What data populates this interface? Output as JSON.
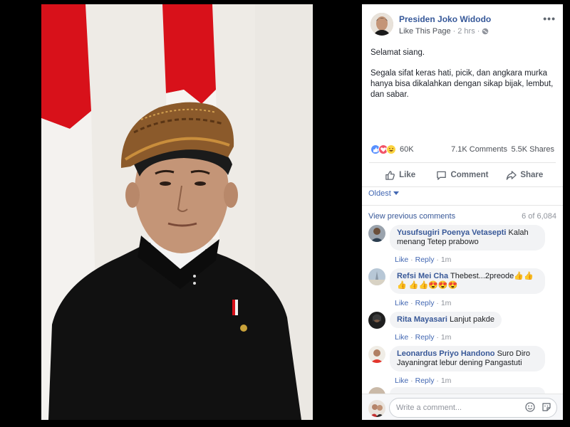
{
  "post": {
    "page_name": "Presiden Joko Widodo",
    "like_page": "Like This Page",
    "time": "2 hrs",
    "privacy_icon": "globe-icon",
    "more_label": "•••",
    "text_lines": [
      "Selamat siang.",
      "Segala sifat keras hati, picik, dan angkara murka hanya bisa dikalahkan dengan sikap bijak, lembut, dan sabar."
    ]
  },
  "stats": {
    "reactions_count": "60K",
    "comments_count": "7.1K Comments",
    "shares_count": "5.5K Shares",
    "reaction_icons": [
      "like-icon",
      "love-icon",
      "haha-icon"
    ]
  },
  "actions": {
    "like": "Like",
    "comment": "Comment",
    "share": "Share"
  },
  "sort": {
    "label": "Oldest"
  },
  "comments_section": {
    "view_previous": "View previous comments",
    "counter": "6 of 6,084",
    "comments": [
      {
        "author": "Yusufsugiri Poenya Vetasepti",
        "text": "Kalah menang Tetep prabowo",
        "like": "Like",
        "reply": "Reply",
        "time": "1m"
      },
      {
        "author": "Refsi Mei Cha",
        "text": "Thebest...2preode👍👍👍 👍👍😍😍😍",
        "like": "Like",
        "reply": "Reply",
        "time": "1m"
      },
      {
        "author": "Rita Mayasari",
        "text": "Lanjut pakde",
        "like": "Like",
        "reply": "Reply",
        "time": "1m"
      },
      {
        "author": "Leonardus Priyo Handono",
        "text": "Suro Diro Jayaningrat lebur dening Pangastuti",
        "like": "Like",
        "reply": "Reply",
        "time": "1m"
      }
    ]
  },
  "composer": {
    "placeholder": "Write a comment..."
  },
  "colors": {
    "link": "#365899",
    "flag_red": "#d8111a",
    "like_blue": "#4267b2"
  }
}
